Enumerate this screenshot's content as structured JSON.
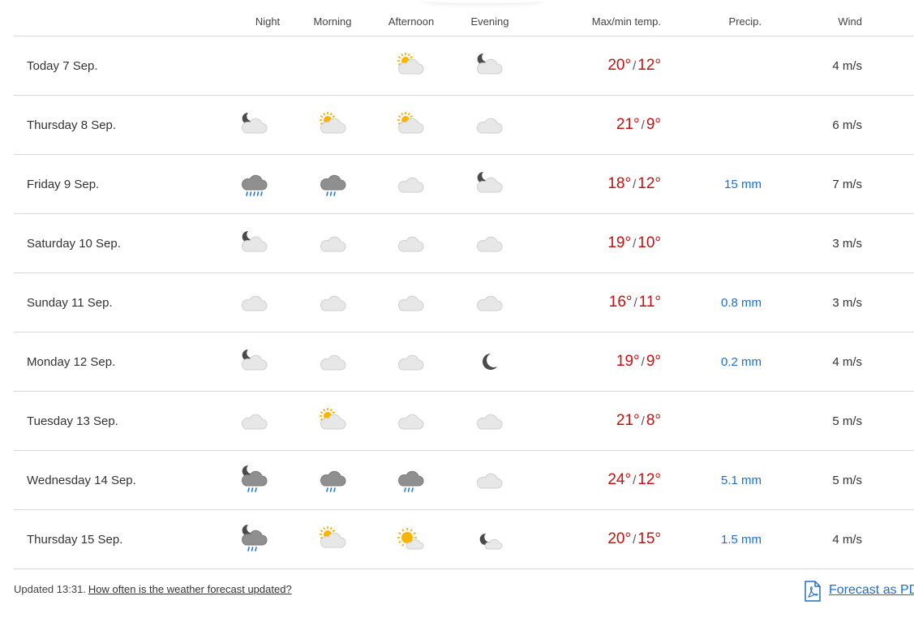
{
  "header": {
    "night": "Night",
    "morning": "Morning",
    "afternoon": "Afternoon",
    "evening": "Evening",
    "maxmin": "Max/min temp.",
    "precip": "Precip.",
    "wind": "Wind"
  },
  "temp_separator": "/",
  "rows": [
    {
      "date": "Today 7 Sep.",
      "night": "",
      "morning": "",
      "afternoon": "partly-cloudy-day-icon",
      "evening": "partly-cloudy-night-icon",
      "max": "20°",
      "min": "12°",
      "precip": "",
      "wind": "4 m/s"
    },
    {
      "date": "Thursday 8 Sep.",
      "night": "partly-cloudy-night-icon",
      "morning": "partly-cloudy-day-icon",
      "afternoon": "partly-cloudy-day-icon",
      "evening": "cloudy-icon",
      "max": "21°",
      "min": "9°",
      "precip": "",
      "wind": "6 m/s"
    },
    {
      "date": "Friday 9 Sep.",
      "night": "heavy-rain-icon",
      "morning": "rain-icon",
      "afternoon": "cloudy-icon",
      "evening": "partly-cloudy-night-icon",
      "max": "18°",
      "min": "12°",
      "precip": "15 mm",
      "wind": "7 m/s"
    },
    {
      "date": "Saturday 10 Sep.",
      "night": "partly-cloudy-night-icon",
      "morning": "cloudy-icon",
      "afternoon": "cloudy-icon",
      "evening": "cloudy-icon",
      "max": "19°",
      "min": "10°",
      "precip": "",
      "wind": "3 m/s"
    },
    {
      "date": "Sunday 11 Sep.",
      "night": "cloudy-icon",
      "morning": "cloudy-icon",
      "afternoon": "cloudy-icon",
      "evening": "cloudy-icon",
      "max": "16°",
      "min": "11°",
      "precip": "0.8 mm",
      "wind": "3 m/s"
    },
    {
      "date": "Monday 12 Sep.",
      "night": "partly-cloudy-night-icon",
      "morning": "cloudy-icon",
      "afternoon": "cloudy-icon",
      "evening": "clear-night-icon",
      "max": "19°",
      "min": "9°",
      "precip": "0.2 mm",
      "wind": "4 m/s"
    },
    {
      "date": "Tuesday 13 Sep.",
      "night": "cloudy-icon",
      "morning": "partly-cloudy-day-icon",
      "afternoon": "cloudy-icon",
      "evening": "cloudy-icon",
      "max": "21°",
      "min": "8°",
      "precip": "",
      "wind": "5 m/s"
    },
    {
      "date": "Wednesday 14 Sep.",
      "night": "rain-night-icon",
      "morning": "rain-icon",
      "afternoon": "rain-icon",
      "evening": "cloudy-icon",
      "max": "24°",
      "min": "12°",
      "precip": "5.1 mm",
      "wind": "5 m/s"
    },
    {
      "date": "Thursday 15 Sep.",
      "night": "rain-night-icon",
      "morning": "partly-cloudy-day-icon",
      "afternoon": "fair-day-icon",
      "evening": "fair-night-icon",
      "max": "20°",
      "min": "15°",
      "precip": "1.5 mm",
      "wind": "4 m/s"
    }
  ],
  "footer": {
    "updated": "Updated 13:31.",
    "help_link": "How often is the weather forecast updated?",
    "pdf_link": "Forecast as PDF"
  },
  "colors": {
    "temp": "#c60f0f",
    "precip": "#1d6ecf",
    "link": "#1d6ecf",
    "divider": "#d8d8d8"
  }
}
